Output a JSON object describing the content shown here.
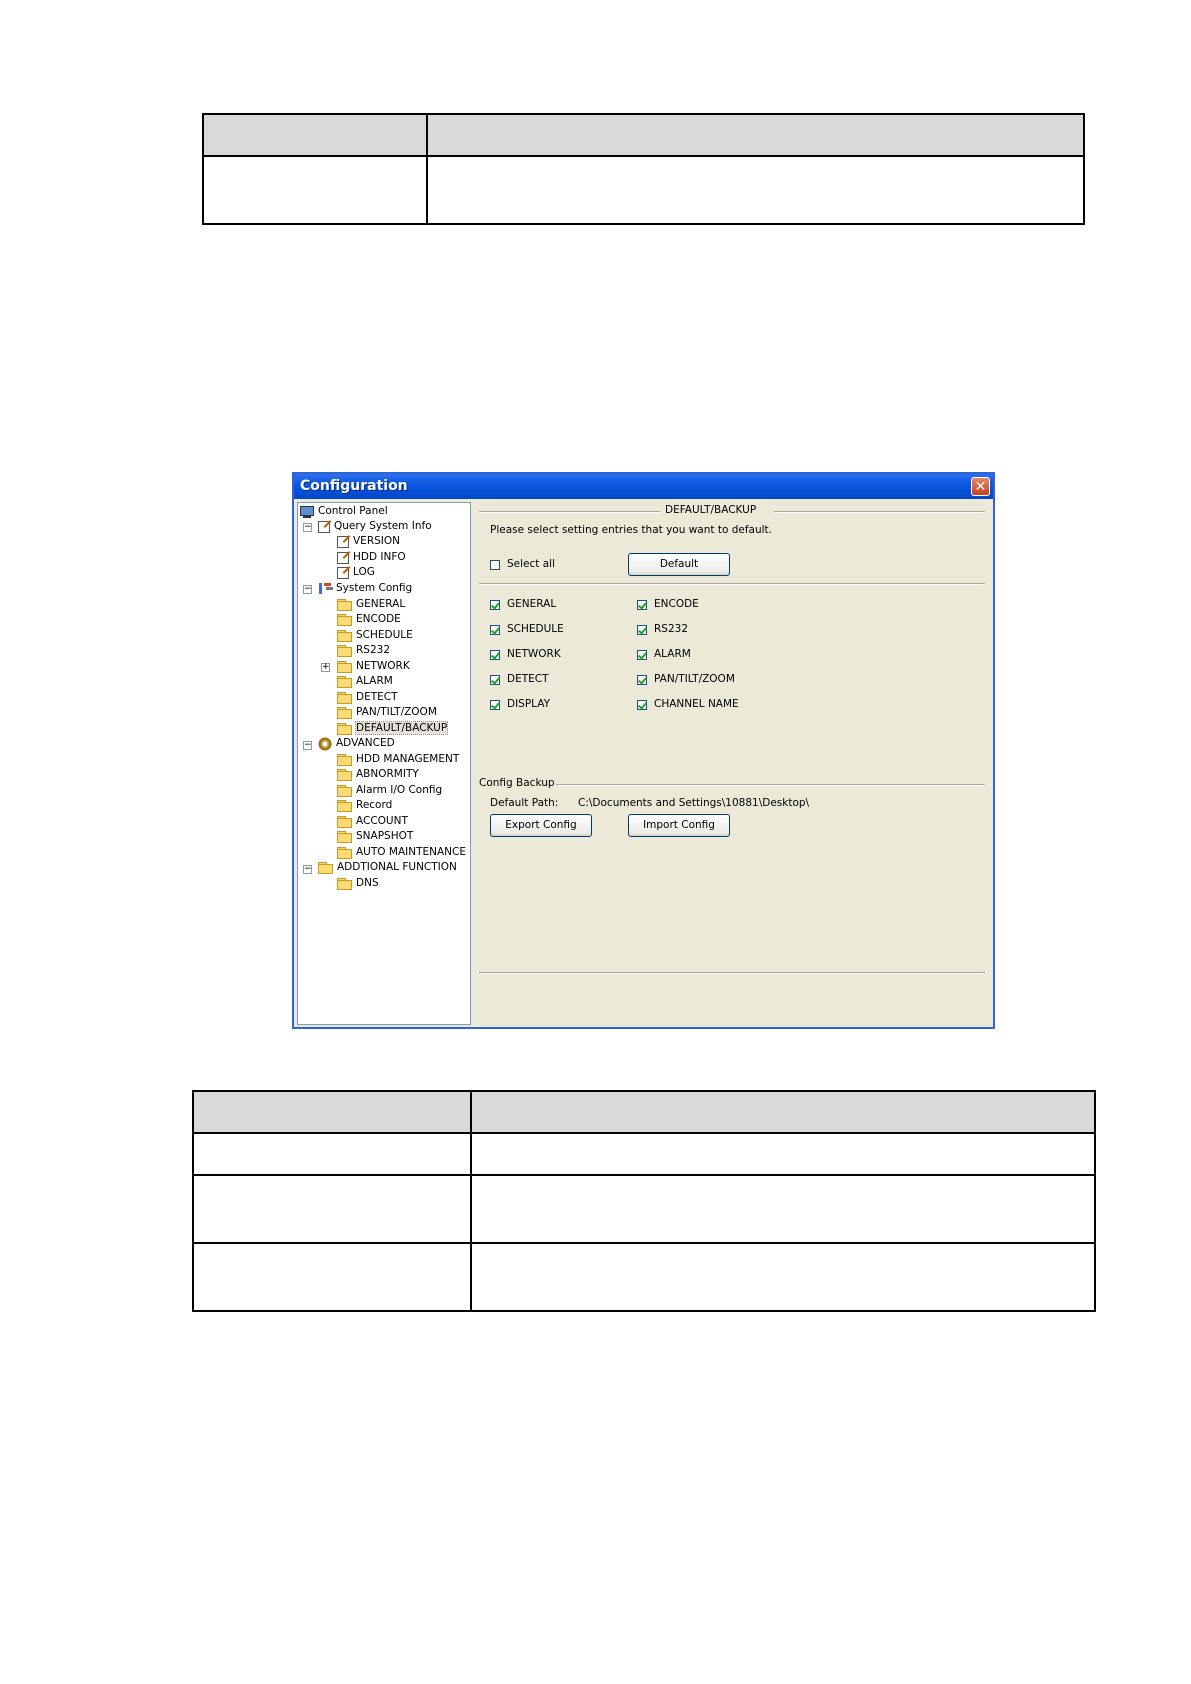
{
  "window": {
    "title": "Configuration",
    "close_glyph": "✕"
  },
  "tree": {
    "control_panel": "Control Panel",
    "query_system_info": "Query System Info",
    "version": "VERSION",
    "hdd_info": "HDD INFO",
    "log": "LOG",
    "system_config": "System Config",
    "general": "GENERAL",
    "encode": "ENCODE",
    "schedule": "SCHEDULE",
    "rs232": "RS232",
    "network": "NETWORK",
    "alarm": "ALARM",
    "detect": "DETECT",
    "ptz": "PAN/TILT/ZOOM",
    "default_backup": "DEFAULT/BACKUP",
    "advanced": "ADVANCED",
    "hdd_management": "HDD MANAGEMENT",
    "abnormity": "ABNORMITY",
    "alarm_io": "Alarm I/O Config",
    "record": "Record",
    "account": "ACCOUNT",
    "snapshot": "SNAPSHOT",
    "auto_maintenance": "AUTO MAINTENANCE",
    "additional_function": "ADDTIONAL FUNCTION",
    "dns": "DNS"
  },
  "panel": {
    "section_title": "DEFAULT/BACKUP",
    "instruction": "Please select setting entries that you want to default.",
    "select_all": "Select all",
    "default_button": "Default",
    "options_left": [
      "GENERAL",
      "SCHEDULE",
      "NETWORK",
      "DETECT",
      "DISPLAY"
    ],
    "options_right": [
      "ENCODE",
      "RS232",
      "ALARM",
      "PAN/TILT/ZOOM",
      "CHANNEL NAME"
    ],
    "config_backup": "Config Backup",
    "default_path_label": "Default Path:",
    "default_path_value": "C:\\Documents and Settings\\10881\\Desktop\\",
    "export_button": "Export Config",
    "import_button": "Import Config"
  }
}
